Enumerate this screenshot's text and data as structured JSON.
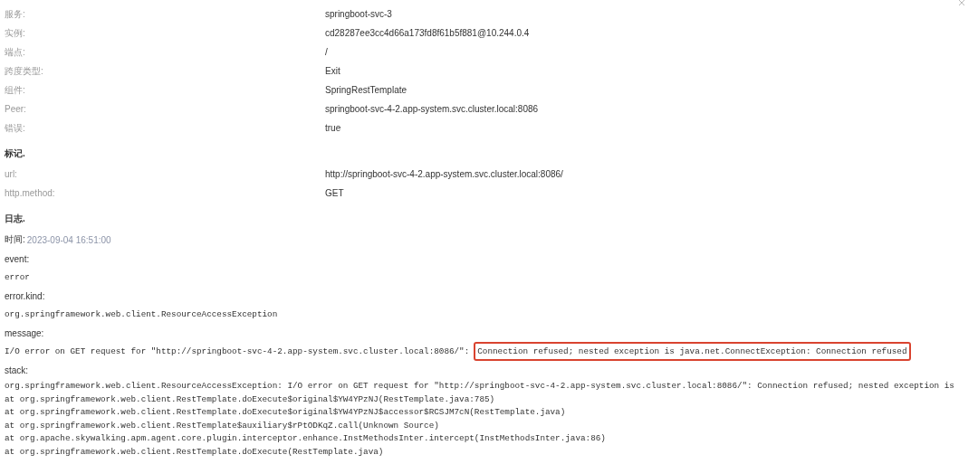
{
  "fields": [
    {
      "label": "服务:",
      "value": "springboot-svc-3"
    },
    {
      "label": "实例:",
      "value": "cd28287ee3cc4d66a173fd8f61b5f881@10.244.0.4"
    },
    {
      "label": "端点:",
      "value": "/"
    },
    {
      "label": "跨度类型:",
      "value": "Exit"
    },
    {
      "label": "组件:",
      "value": "SpringRestTemplate"
    },
    {
      "label": "Peer:",
      "value": "springboot-svc-4-2.app-system.svc.cluster.local:8086"
    },
    {
      "label": "错误:",
      "value": "true"
    }
  ],
  "tags": {
    "title": "标记.",
    "items": [
      {
        "label": "url:",
        "value": "http://springboot-svc-4-2.app-system.svc.cluster.local:8086/"
      },
      {
        "label": "http.method:",
        "value": "GET"
      }
    ]
  },
  "logs": {
    "title": "日志.",
    "time_label": "时间:",
    "time": "2023-09-04 16:51:00",
    "entries": [
      {
        "key": "event:",
        "parts": [
          {
            "text": "error",
            "highlighted": false
          }
        ]
      },
      {
        "key": "error.kind:",
        "parts": [
          {
            "text": "org.springframework.web.client.ResourceAccessException",
            "highlighted": false
          }
        ]
      },
      {
        "key": "message:",
        "parts": [
          {
            "text": "I/O error on GET request for \"http://springboot-svc-4-2.app-system.svc.cluster.local:8086/\":",
            "highlighted": false
          },
          {
            "text": "Connection refused; nested exception is java.net.ConnectException: Connection refused",
            "highlighted": true
          }
        ]
      },
      {
        "key": "stack:",
        "lines": [
          "org.springframework.web.client.ResourceAccessException: I/O error on GET request for \"http://springboot-svc-4-2.app-system.svc.cluster.local:8086/\": Connection refused; nested exception is",
          "at org.springframework.web.client.RestTemplate.doExecute$original$YW4YPzNJ(RestTemplate.java:785)",
          "at org.springframework.web.client.RestTemplate.doExecute$original$YW4YPzNJ$accessor$RCSJM7cN(RestTemplate.java)",
          "at org.springframework.web.client.RestTemplate$auxiliary$rPtODKqZ.call(Unknown Source)",
          "at org.apache.skywalking.apm.agent.core.plugin.interceptor.enhance.InstMethodsInter.intercept(InstMethodsInter.java:86)",
          "at org.springframework.web.client.RestTemplate.doExecute(RestTemplate.java)"
        ]
      }
    ]
  }
}
